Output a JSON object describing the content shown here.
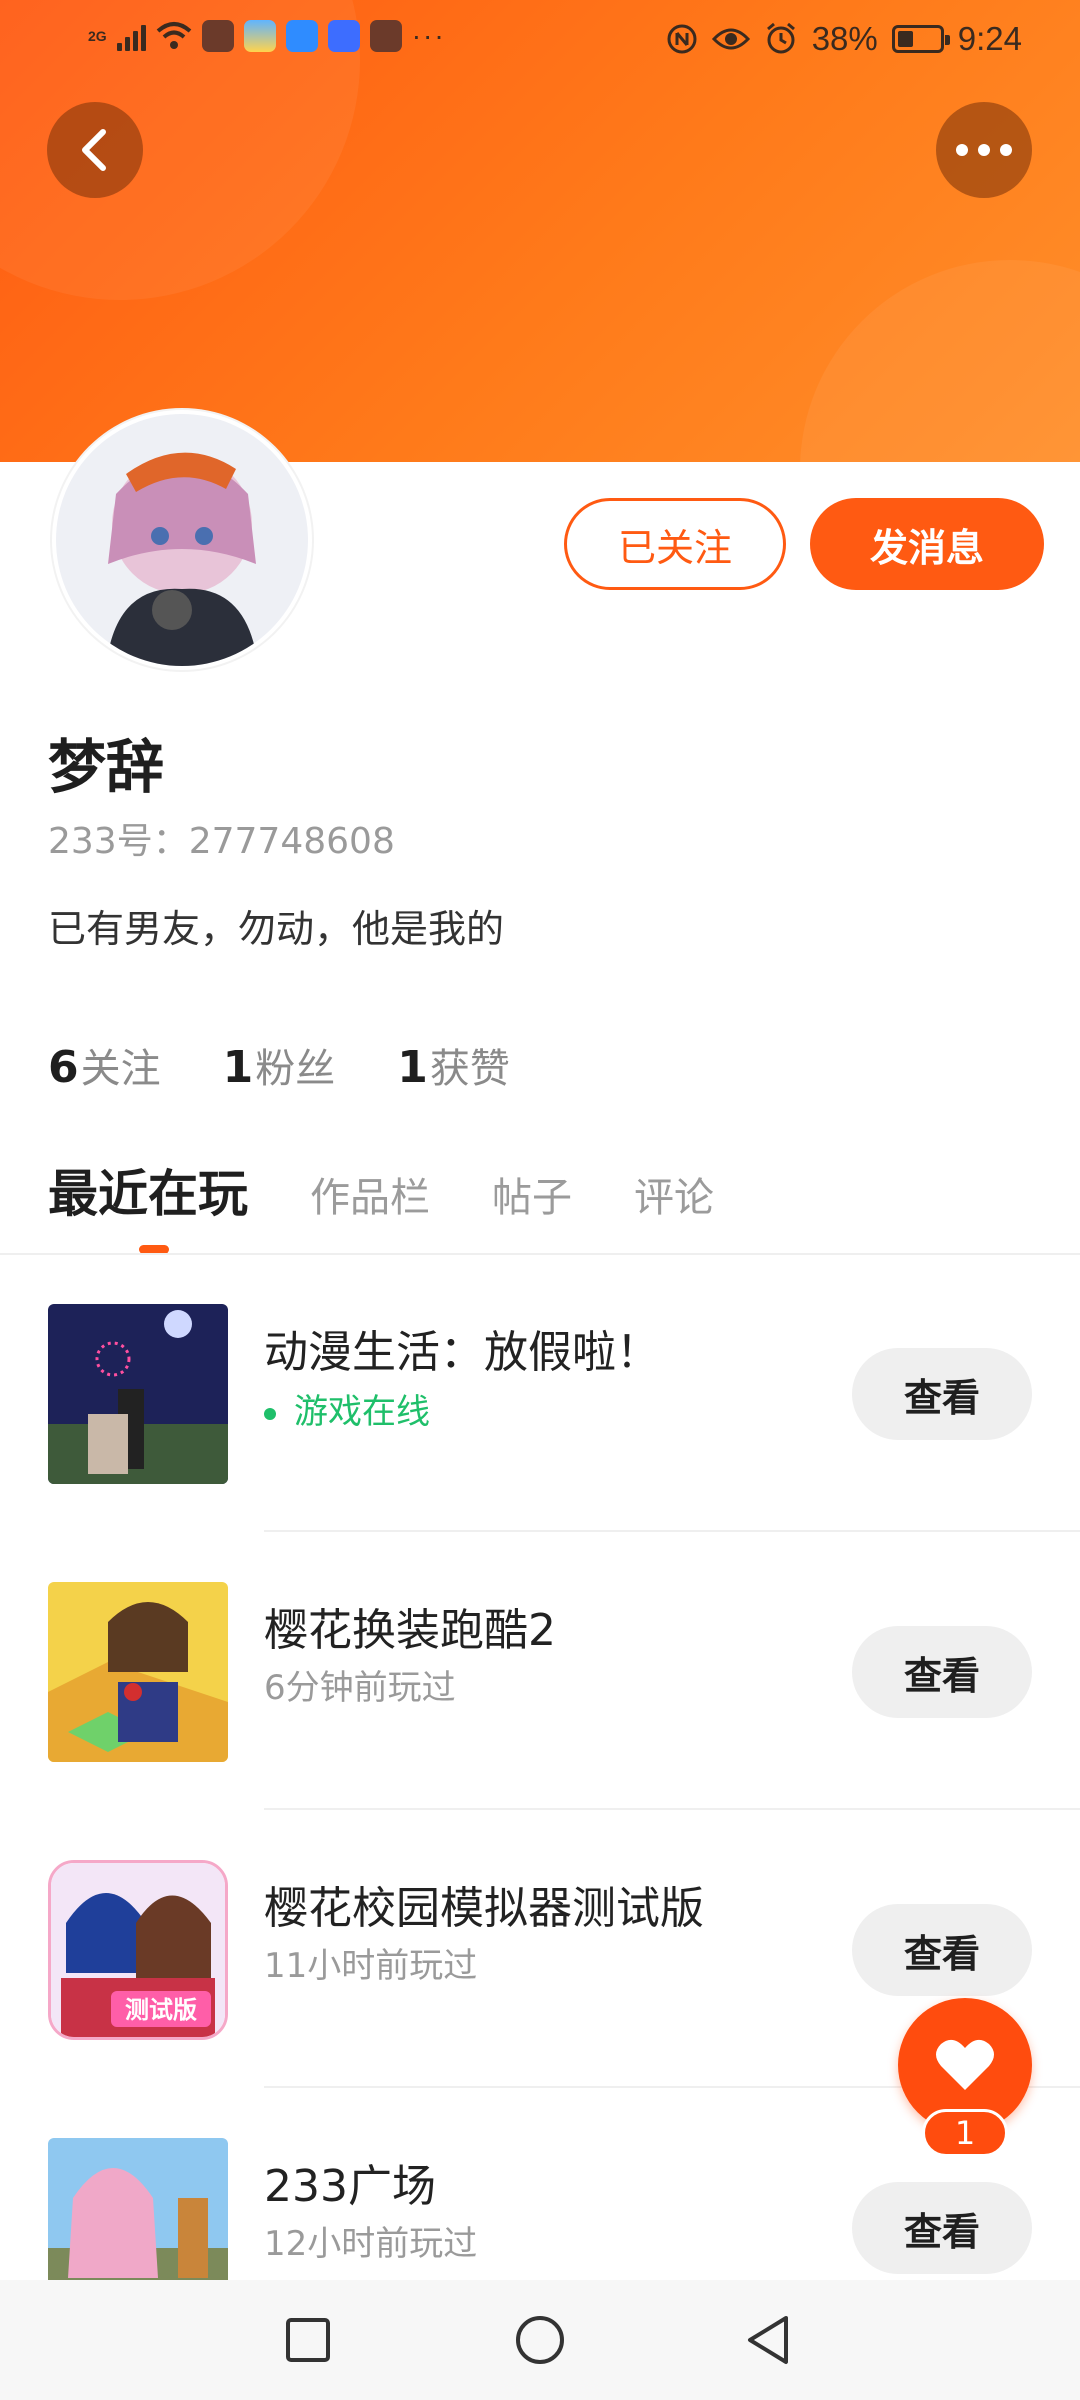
{
  "status_bar": {
    "network": "2G",
    "battery": "38%",
    "battery_fraction": 0.38,
    "time": "9:24",
    "more_indicator": "···"
  },
  "icons": {
    "back": "chevron-left-icon",
    "more": "more-horizontal-icon",
    "like": "heart-icon"
  },
  "colors": {
    "brand": "#ff5a12",
    "online": "#1fbf6a",
    "button_gray": "#efefef"
  },
  "profile": {
    "name": "梦辞",
    "id_text": "233号：277748608",
    "bio": "已有男友，勿动，他是我的",
    "follow_label": "已关注",
    "message_label": "发消息"
  },
  "stats": [
    {
      "num": "6",
      "label": "关注"
    },
    {
      "num": "1",
      "label": "粉丝"
    },
    {
      "num": "1",
      "label": "获赞"
    }
  ],
  "tabs": [
    {
      "label": "最近在玩",
      "active": true
    },
    {
      "label": "作品栏"
    },
    {
      "label": "帖子"
    },
    {
      "label": "评论"
    }
  ],
  "games": [
    {
      "title": "动漫生活：放假啦！",
      "subtitle": "游戏在线",
      "online": true,
      "button": "查看"
    },
    {
      "title": "樱花换装跑酷2",
      "subtitle": "6分钟前玩过",
      "online": false,
      "button": "查看"
    },
    {
      "title": "樱花校园模拟器测试版",
      "subtitle": "11小时前玩过",
      "online": false,
      "button": "查看",
      "badge": "测试版"
    },
    {
      "title": "233广场",
      "subtitle": "12小时前玩过",
      "online": false,
      "button": "查看"
    }
  ],
  "fab": {
    "count": "1"
  }
}
